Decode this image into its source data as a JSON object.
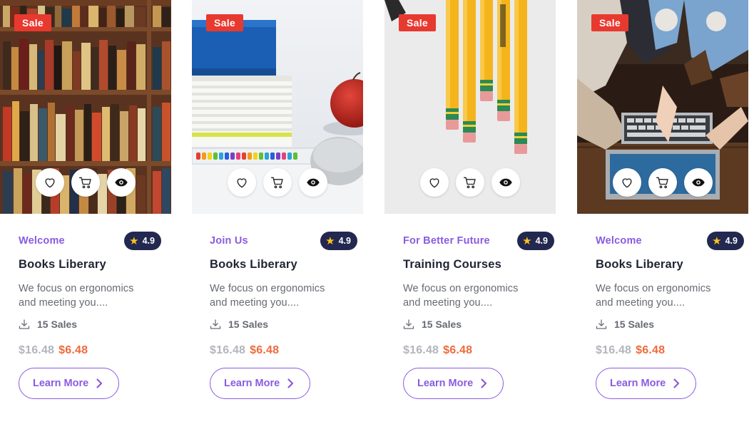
{
  "cards": [
    {
      "badge": "Sale",
      "category": "Welcome",
      "rating": "4.9",
      "title": "Books Liberary",
      "description": "We focus on ergonomics and meeting you....",
      "sales": "15 Sales",
      "old_price": "$16.48",
      "new_price": "$6.48",
      "cta": "Learn More",
      "image": "bookshelf-photo"
    },
    {
      "badge": "Sale",
      "category": "Join Us",
      "rating": "4.9",
      "title": "Books Liberary",
      "description": "We focus on ergonomics and meeting you....",
      "sales": "15 Sales",
      "old_price": "$16.48",
      "new_price": "$6.48",
      "cta": "Learn More",
      "image": "notebooks-apple-photo"
    },
    {
      "badge": "Sale",
      "category": "For Better Future",
      "rating": "4.9",
      "title": "Training Courses",
      "description": "We focus on ergonomics and meeting you....",
      "sales": "15 Sales",
      "old_price": "$16.48",
      "new_price": "$6.48",
      "cta": "Learn More",
      "image": "pencils-photo"
    },
    {
      "badge": "Sale",
      "category": "Welcome",
      "rating": "4.9",
      "title": "Books Liberary",
      "description": "We focus on ergonomics and meeting you....",
      "sales": "15 Sales",
      "old_price": "$16.48",
      "new_price": "$6.48",
      "cta": "Learn More",
      "image": "students-laptop-photo"
    }
  ],
  "icons": {
    "wishlist": "heart-icon",
    "cart": "cart-icon",
    "quick_view": "eye-icon",
    "rating": "star-icon",
    "sales": "download-icon",
    "cta": "chevron-right-icon"
  },
  "colors": {
    "badge": "#e8392f",
    "category": "#8a5be0",
    "rating_bg": "#22284f",
    "star": "#ffc21b",
    "new_price": "#f06a3b",
    "old_price": "#b3b5bb"
  }
}
